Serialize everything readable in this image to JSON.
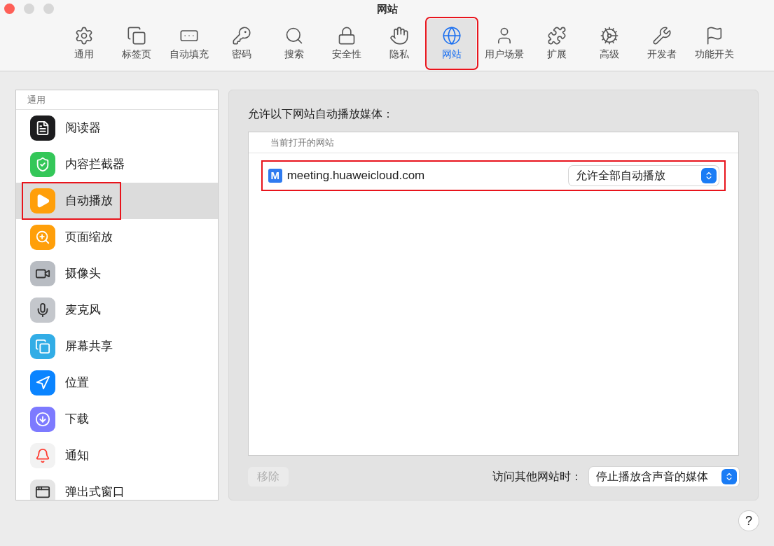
{
  "window": {
    "title": "网站"
  },
  "toolbar": [
    {
      "label": "通用",
      "selected": false,
      "highlighted": false
    },
    {
      "label": "标签页",
      "selected": false,
      "highlighted": false
    },
    {
      "label": "自动填充",
      "selected": false,
      "highlighted": false
    },
    {
      "label": "密码",
      "selected": false,
      "highlighted": false
    },
    {
      "label": "搜索",
      "selected": false,
      "highlighted": false
    },
    {
      "label": "安全性",
      "selected": false,
      "highlighted": false
    },
    {
      "label": "隐私",
      "selected": false,
      "highlighted": false
    },
    {
      "label": "网站",
      "selected": true,
      "highlighted": true
    },
    {
      "label": "用户场景",
      "selected": false,
      "highlighted": false
    },
    {
      "label": "扩展",
      "selected": false,
      "highlighted": false
    },
    {
      "label": "高级",
      "selected": false,
      "highlighted": false
    },
    {
      "label": "开发者",
      "selected": false,
      "highlighted": false
    },
    {
      "label": "功能开关",
      "selected": false,
      "highlighted": false
    }
  ],
  "sidebar": {
    "header": "通用",
    "items": [
      {
        "label": "阅读器",
        "selected": false,
        "highlighted": false
      },
      {
        "label": "内容拦截器",
        "selected": false,
        "highlighted": false
      },
      {
        "label": "自动播放",
        "selected": true,
        "highlighted": true
      },
      {
        "label": "页面缩放",
        "selected": false,
        "highlighted": false
      },
      {
        "label": "摄像头",
        "selected": false,
        "highlighted": false
      },
      {
        "label": "麦克风",
        "selected": false,
        "highlighted": false
      },
      {
        "label": "屏幕共享",
        "selected": false,
        "highlighted": false
      },
      {
        "label": "位置",
        "selected": false,
        "highlighted": false
      },
      {
        "label": "下载",
        "selected": false,
        "highlighted": false
      },
      {
        "label": "通知",
        "selected": false,
        "highlighted": false
      },
      {
        "label": "弹出式窗口",
        "selected": false,
        "highlighted": false
      }
    ]
  },
  "panel": {
    "heading": "允许以下网站自动播放媒体：",
    "list_header": "当前打开的网站",
    "sites": [
      {
        "favicon": "M",
        "domain": "meeting.huaweicloud.com",
        "setting": "允许全部自动播放",
        "highlighted": true
      }
    ],
    "remove_button": {
      "label": "移除",
      "disabled": true
    },
    "other_sites_label": "访问其他网站时：",
    "other_sites_setting": "停止播放含声音的媒体"
  },
  "help_button": "?"
}
